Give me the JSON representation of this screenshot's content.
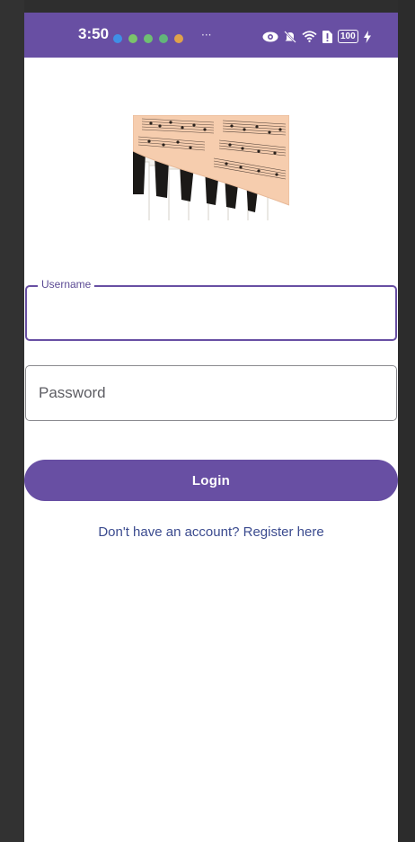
{
  "status_bar": {
    "time": "3:50",
    "notification_icons": [
      "app-notification-icon",
      "app-notification-icon",
      "app-notification-icon",
      "app-notification-icon",
      "app-notification-icon"
    ],
    "more": "···",
    "battery": "100",
    "colors": {
      "background": "#684fa3"
    }
  },
  "header": {
    "image": "sheet-music-piano-image"
  },
  "form": {
    "username": {
      "label": "Username",
      "value": ""
    },
    "password": {
      "placeholder": "Password",
      "value": ""
    },
    "login_label": "Login",
    "register_text": "Don't have an account? Register here"
  },
  "theme": {
    "primary": "#684fa3",
    "link": "#3b4b8f"
  }
}
